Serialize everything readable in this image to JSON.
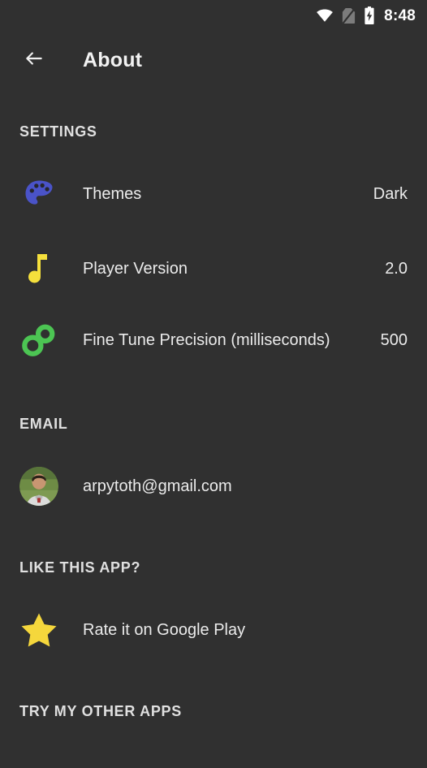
{
  "status_bar": {
    "time": "8:48",
    "icons": [
      "wifi-icon",
      "no-sim-icon",
      "battery-charging-icon"
    ]
  },
  "app_bar": {
    "back_icon": "back-arrow-icon",
    "title": "About"
  },
  "sections": [
    {
      "header": "SETTINGS",
      "rows": [
        {
          "icon": "palette-icon",
          "icon_color": "#4a53c8",
          "label": "Themes",
          "value": "Dark"
        },
        {
          "icon": "music-note-icon",
          "icon_color": "#f5e03c",
          "label": "Player Version",
          "value": "2.0"
        },
        {
          "icon": "link-circles-icon",
          "icon_color": "#4cc553",
          "label": "Fine Tune Precision (milliseconds)",
          "value": "500"
        }
      ]
    },
    {
      "header": "EMAIL",
      "rows": [
        {
          "icon": "user-avatar",
          "label": "arpytoth@gmail.com",
          "value": ""
        }
      ]
    },
    {
      "header": "LIKE THIS APP?",
      "rows": [
        {
          "icon": "star-icon",
          "icon_color": "#f5d73c",
          "label": "Rate it on Google Play",
          "value": ""
        }
      ]
    },
    {
      "header": "TRY MY OTHER APPS",
      "rows": []
    }
  ],
  "theme": {
    "background": "#303030",
    "text_primary": "#ebebeb",
    "text_header": "#e0e0e0"
  }
}
